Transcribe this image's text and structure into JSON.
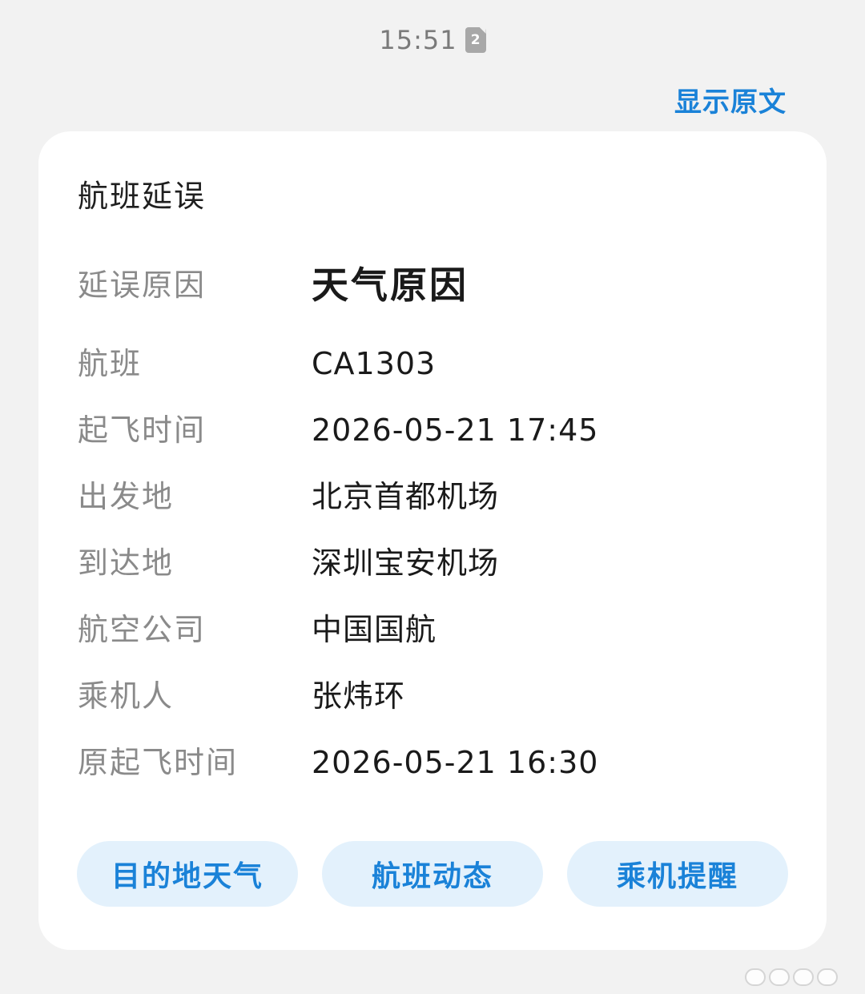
{
  "status_bar": {
    "time": "15:51",
    "badge": "2"
  },
  "header": {
    "show_original": "显示原文"
  },
  "card": {
    "title": "航班延误",
    "rows": [
      {
        "label": "延误原因",
        "value": "天气原因"
      },
      {
        "label": "航班",
        "value": "CA1303"
      },
      {
        "label": "起飞时间",
        "value": "2026-05-21 17:45"
      },
      {
        "label": "出发地",
        "value": "北京首都机场"
      },
      {
        "label": "到达地",
        "value": "深圳宝安机场"
      },
      {
        "label": "航空公司",
        "value": "中国国航"
      },
      {
        "label": "乘机人",
        "value": "张炜环"
      },
      {
        "label": "原起飞时间",
        "value": "2026-05-21 16:30"
      }
    ],
    "actions": [
      {
        "label": "目的地天气"
      },
      {
        "label": "航班动态"
      },
      {
        "label": "乘机提醒"
      }
    ]
  },
  "colors": {
    "accent": "#1a82d8",
    "pill_bg": "#e3f1fc",
    "label_gray": "#8a8a8a",
    "page_bg": "#f2f2f2"
  }
}
